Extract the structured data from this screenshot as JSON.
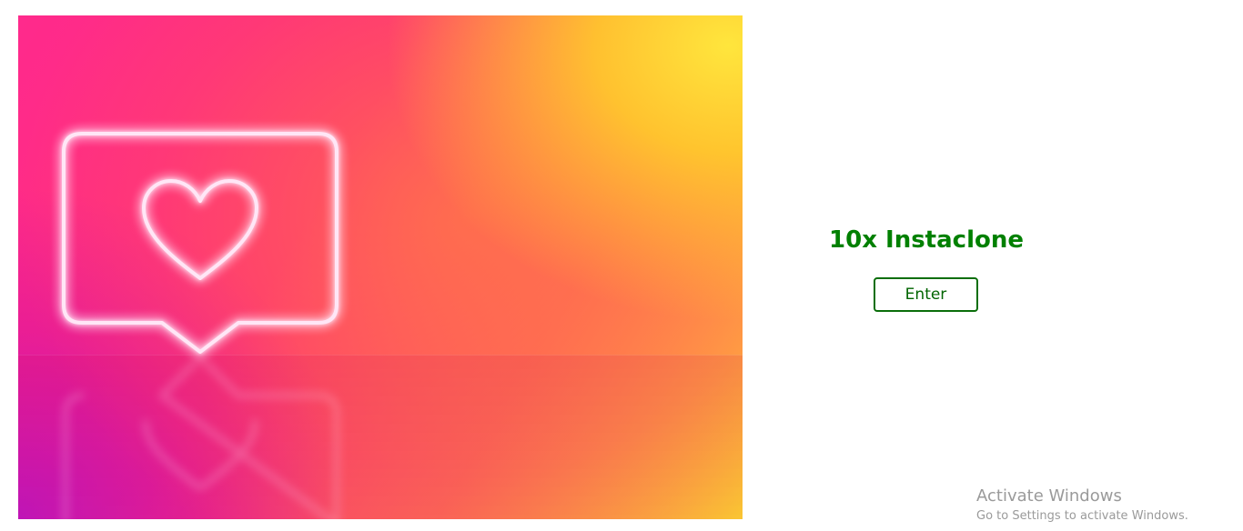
{
  "hero": {
    "icon": "heart-notification-bubble-icon",
    "colors": {
      "pink": "#ff2a8c",
      "orange": "#ff7a45",
      "yellow": "#ffe03c",
      "neon": "#ffffff"
    }
  },
  "landing": {
    "title": "10x Instaclone",
    "enter_label": "Enter",
    "accent_color": "#008000"
  },
  "watermark": {
    "title": "Activate Windows",
    "subtitle": "Go to Settings to activate Windows."
  }
}
